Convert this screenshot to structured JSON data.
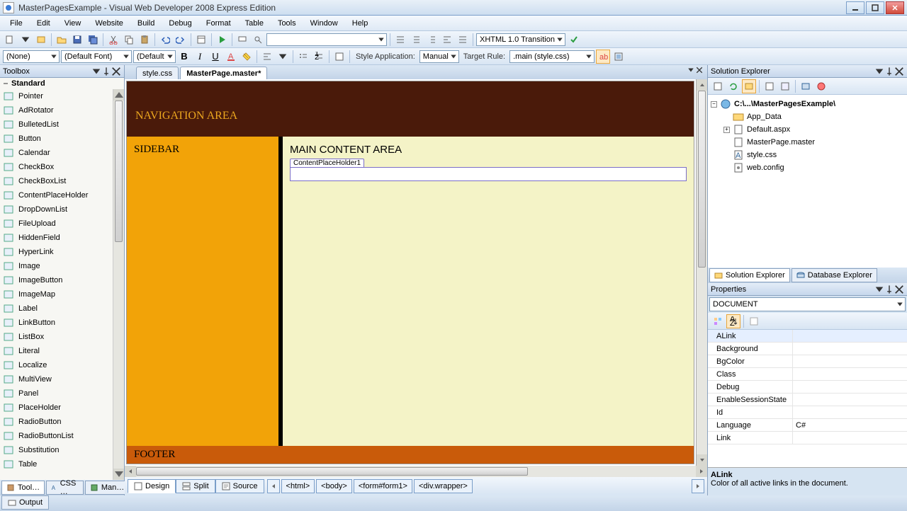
{
  "window": {
    "title": "MasterPagesExample - Visual Web Developer 2008 Express Edition"
  },
  "menus": [
    "File",
    "Edit",
    "View",
    "Website",
    "Build",
    "Debug",
    "Format",
    "Table",
    "Tools",
    "Window",
    "Help"
  ],
  "format_toolbar": {
    "element": "(None)",
    "font": "(Default Font)",
    "size": "(Default",
    "style_app_label": "Style Application:",
    "style_app_value": "Manual",
    "target_rule_label": "Target Rule:",
    "target_rule_value": ".main (style.css)",
    "doctype": "XHTML 1.0 Transition"
  },
  "toolbox": {
    "title": "Toolbox",
    "section": "Standard",
    "items": [
      "Pointer",
      "AdRotator",
      "BulletedList",
      "Button",
      "Calendar",
      "CheckBox",
      "CheckBoxList",
      "ContentPlaceHolder",
      "DropDownList",
      "FileUpload",
      "HiddenField",
      "HyperLink",
      "Image",
      "ImageButton",
      "ImageMap",
      "Label",
      "LinkButton",
      "ListBox",
      "Literal",
      "Localize",
      "MultiView",
      "Panel",
      "PlaceHolder",
      "RadioButton",
      "RadioButtonList",
      "Substitution",
      "Table"
    ]
  },
  "left_tabs": {
    "a": "Tool…",
    "b": "CSS …",
    "c": "Man…"
  },
  "editor": {
    "tabs": [
      "style.css",
      "MasterPage.master*"
    ],
    "active_tab": 1,
    "canvas": {
      "nav": "NAVIGATION AREA",
      "sidebar": "SIDEBAR",
      "main_heading": "MAIN CONTENT AREA",
      "placeholder": "ContentPlaceHolder1",
      "footer": "FOOTER"
    },
    "views": {
      "design": "Design",
      "split": "Split",
      "source": "Source"
    },
    "breadcrumb": [
      "<html>",
      "<body>",
      "<form#form1>",
      "<div.wrapper>"
    ]
  },
  "solution": {
    "title": "Solution Explorer",
    "root": "C:\\...\\MasterPagesExample\\",
    "nodes": [
      "App_Data",
      "Default.aspx",
      "MasterPage.master",
      "style.css",
      "web.config"
    ],
    "tabs": {
      "a": "Solution Explorer",
      "b": "Database Explorer"
    }
  },
  "properties": {
    "title": "Properties",
    "object": "DOCUMENT",
    "rows": [
      {
        "name": "ALink",
        "val": ""
      },
      {
        "name": "Background",
        "val": ""
      },
      {
        "name": "BgColor",
        "val": ""
      },
      {
        "name": "Class",
        "val": ""
      },
      {
        "name": "Debug",
        "val": ""
      },
      {
        "name": "EnableSessionState",
        "val": ""
      },
      {
        "name": "Id",
        "val": ""
      },
      {
        "name": "Language",
        "val": "C#"
      },
      {
        "name": "Link",
        "val": ""
      }
    ],
    "help_name": "ALink",
    "help_desc": "Color of all active links in the document."
  },
  "bottom_tabs": {
    "output": "Output"
  }
}
